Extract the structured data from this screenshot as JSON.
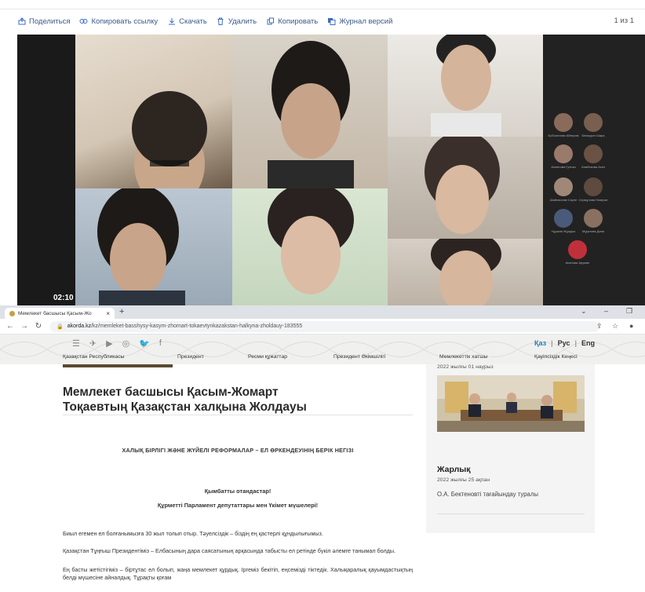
{
  "file_toolbar": {
    "share": "Поделиться",
    "copy_link": "Копировать ссылку",
    "download": "Скачать",
    "delete": "Удалить",
    "copy": "Копировать",
    "history": "Журнал версий",
    "page_count": "1 из 1"
  },
  "video": {
    "timestamp": "02:10",
    "participants": [
      "Ерболатова Айгерим",
      "Бекмурат Шара",
      "Ахметова Гулназ",
      "Хамбекова Асел",
      "Шайхислам Сауле",
      "Серікұлова Назерке",
      "Нұржан Жұлдыз",
      "Мұқатова Дана",
      "Асанова Аружан"
    ]
  },
  "browser": {
    "tab_title": "Мемлекет басшысы Қасым-Жо",
    "new_tab": "+",
    "url_host": "akorda.kz",
    "url_path": "/kz/memleket-basshysy-kasym-zhomart-tokaevtynkazakstan-halkyna-zholdauy-183555"
  },
  "site": {
    "languages": [
      "Қаз",
      "Рус",
      "Eng"
    ],
    "active_language": "Қаз",
    "nav": [
      "Қазақстан Республикасы",
      "Президент",
      "Ресми құжаттар",
      "Президент Әкімшілігі",
      "Мемлекеттік хатшы",
      "Қауіпсіздік Кеңесі"
    ]
  },
  "article": {
    "title_line1": "Мемлекет басшысы Қасым-Жомарт",
    "title_line2": "Тоқаевтың Қазақстан халқына Жолдауы",
    "subtitle": "ХАЛЫҚ БІРЛІГІ ЖӘНЕ ЖҮЙЕЛІ РЕФОРМАЛАР – ЕЛ ӨРКЕНДЕУІНІҢ БЕРІК НЕГІЗІ",
    "greeting1": "Қымбатты отандастар!",
    "greeting2": "Құрметті Парламент депутаттары мен Үкімет мүшелері!",
    "paragraphs": [
      "Биыл егемен ел болғанымызға 30 жыл толып отыр. Тәуелсіздік – біздің ең қастерлі құндылығымыз.",
      "Қазақстан Тұңғыш Президентіміз – Елбасының дара саясатының арқасында табысты ел ретінде бүкіл әлемге танымал болды.",
      "Ең басты жетістігіміз – біртұтас ел болып, жаңа мемлекет құрдық. Іргеміз бекітіп, еңсемізді тіктедік. Халықаралық қауымдастықтың белді мүшесіне айналдық. Тұрақты қоғам"
    ]
  },
  "sidebar": {
    "date1": "2022 жылғы 01 наурыз",
    "heading": "Жарлық",
    "date2": "2022 жылғы 25 ақпан",
    "link": "О.А. Бектеновті тағайындау туралы"
  }
}
